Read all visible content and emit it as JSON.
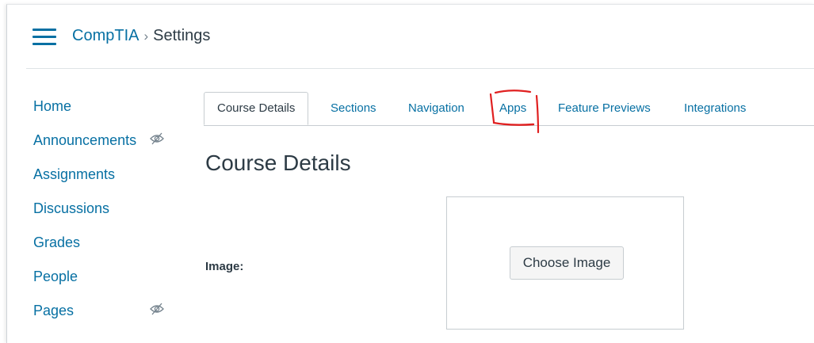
{
  "breadcrumb": {
    "course": "CompTIA",
    "separator": "›",
    "current": "Settings"
  },
  "sidebar": {
    "items": [
      {
        "label": "Home",
        "hidden_icon": false
      },
      {
        "label": "Announcements",
        "hidden_icon": true
      },
      {
        "label": "Assignments",
        "hidden_icon": false
      },
      {
        "label": "Discussions",
        "hidden_icon": false
      },
      {
        "label": "Grades",
        "hidden_icon": false
      },
      {
        "label": "People",
        "hidden_icon": false
      },
      {
        "label": "Pages",
        "hidden_icon": true
      }
    ]
  },
  "tabs": [
    {
      "label": "Course Details",
      "active": true
    },
    {
      "label": "Sections",
      "active": false
    },
    {
      "label": "Navigation",
      "active": false
    },
    {
      "label": "Apps",
      "active": false,
      "annotated": true
    },
    {
      "label": "Feature Previews",
      "active": false
    },
    {
      "label": "Integrations",
      "active": false
    }
  ],
  "main": {
    "title": "Course Details",
    "image_label": "Image:",
    "choose_image_label": "Choose Image"
  },
  "colors": {
    "link": "#0770a3",
    "text": "#2d3b45",
    "annotation": "#e02020",
    "border": "#c7cdd1"
  },
  "icons": {
    "menu": "hamburger-icon",
    "hidden": "eye-slash-icon"
  }
}
